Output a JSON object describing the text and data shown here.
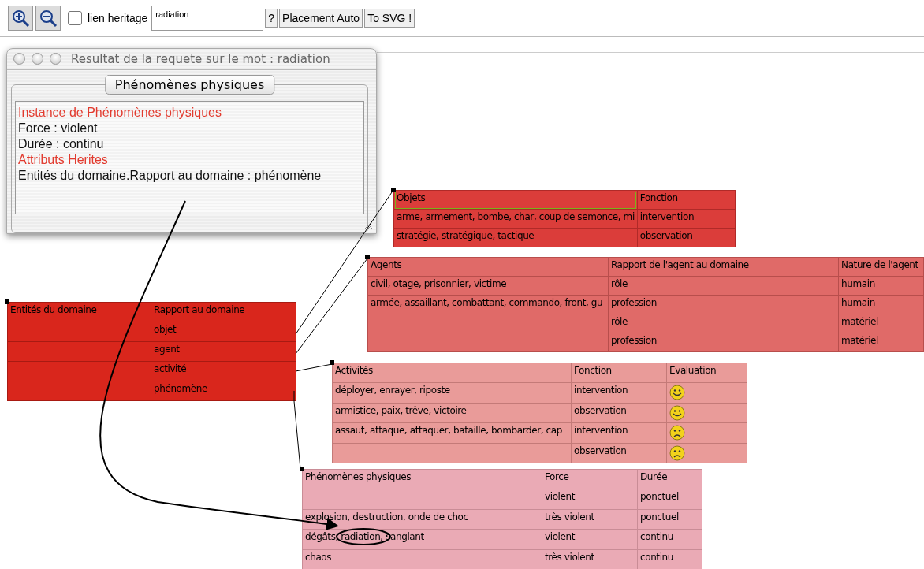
{
  "toolbar": {
    "heritage_checkbox": {
      "label": "lien heritage",
      "checked": false
    },
    "search": {
      "value": "radiation"
    },
    "buttons": [
      "?",
      "Placement Auto",
      "To SVG !"
    ]
  },
  "result_window": {
    "title": "Resultat de la requete sur le mot : radiation",
    "group_title": "Phénomènes physiques",
    "lines": [
      {
        "kind": "heading",
        "text": "Instance de Phénomènes physiques"
      },
      {
        "kind": "attribute",
        "text": "Force : violent"
      },
      {
        "kind": "attribute",
        "text": "Durée : continu"
      },
      {
        "kind": "heading",
        "text": "Attributs Herites"
      },
      {
        "kind": "attribute",
        "text": "Entités du domaine.Rapport au domaine : phénomène"
      }
    ]
  },
  "tables": [
    {
      "columns": [
        {
          "label": "Objets",
          "selected": true
        },
        {
          "label": "Fonction",
          "selected": false
        }
      ],
      "rows": [
        {
          "cells": [
            "arme, armement, bombe, char, coup de semonce, mi",
            "intervention"
          ]
        },
        {
          "cells": [
            "stratégie, stratégique, tactique",
            "observation"
          ]
        }
      ]
    },
    {
      "columns": [
        {
          "label": "Agents",
          "selected": false
        },
        {
          "label": "Rapport de l'agent au domaine",
          "selected": false
        },
        {
          "label": "Nature de l'agent",
          "selected": false
        }
      ],
      "rows": [
        {
          "cells": [
            "civil, otage, prisonnier, victime",
            "rôle",
            "humain"
          ]
        },
        {
          "cells": [
            "armée, assaillant, combattant, commando, front, gu",
            "profession",
            "humain"
          ]
        },
        {
          "cells": [
            null,
            "rôle",
            "matériel"
          ]
        },
        {
          "cells": [
            null,
            "profession",
            "matériel"
          ]
        }
      ]
    },
    {
      "columns": [
        {
          "label": "Entités du domaine",
          "selected": false
        },
        {
          "label": "Rapport au domaine",
          "selected": false
        }
      ],
      "rows": [
        {
          "cells": [
            null,
            "objet"
          ]
        },
        {
          "cells": [
            null,
            "agent"
          ]
        },
        {
          "cells": [
            null,
            "activité"
          ]
        },
        {
          "cells": [
            null,
            "phénomène"
          ]
        }
      ]
    },
    {
      "columns": [
        {
          "label": "Activités",
          "selected": false
        },
        {
          "label": "Fonction",
          "selected": false
        },
        {
          "label": "Evaluation",
          "selected": false
        }
      ],
      "rows": [
        {
          "cells": [
            "déployer, enrayer, riposte",
            "intervention"
          ],
          "happy": true
        },
        {
          "cells": [
            "armistice, paix, trêve, victoire",
            "observation"
          ],
          "happy": true
        },
        {
          "cells": [
            "assaut, attaque, attaquer, bataille, bombarder, cap",
            "intervention"
          ],
          "happy": false
        },
        {
          "cells": [
            null,
            "observation"
          ],
          "happy": false
        }
      ]
    },
    {
      "columns": [
        {
          "label": "Phénomènes physiques",
          "selected": false
        },
        {
          "label": "Force",
          "selected": false
        },
        {
          "label": "Durée",
          "selected": false
        }
      ],
      "rows": [
        {
          "cells": [
            null,
            "violent",
            "ponctuel"
          ]
        },
        {
          "cells": [
            "explosion, destruction, onde de choc",
            "très violent",
            "ponctuel"
          ]
        },
        {
          "cells": [
            "dégâts, radiation, sanglant",
            "violent",
            "continu"
          ]
        },
        {
          "cells": [
            "chaos",
            "très violent",
            "continu"
          ]
        }
      ]
    }
  ]
}
